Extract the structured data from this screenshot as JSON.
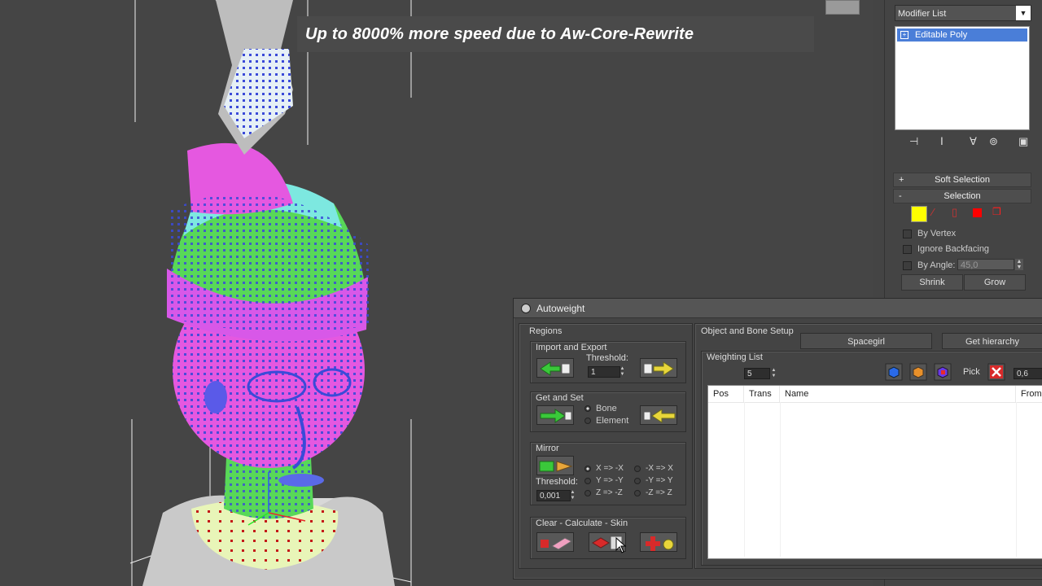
{
  "viewport": {
    "overlay_text": "Up to 8000% more speed due to Aw-Core-Rewrite"
  },
  "command_panel": {
    "modifier_list": "Modifier List",
    "modifier_dropdown_arrow": "▼",
    "stack_items": [
      "Editable Poly"
    ],
    "rollouts": {
      "soft_selection": {
        "sign": "+",
        "label": "Soft Selection"
      },
      "selection": {
        "sign": "-",
        "label": "Selection"
      }
    },
    "checkboxes": {
      "by_vertex": "By Vertex",
      "ignore_backfacing": "Ignore Backfacing",
      "by_angle": "By Angle:"
    },
    "angle_value": "45,0",
    "shrink_label": "Shrink",
    "grow_label": "Grow",
    "colors": {
      "selection_highlight": "#4a7ed8",
      "vertex_icon": "#ffff00",
      "red_icons": "#ff0000"
    }
  },
  "autoweight": {
    "title": "Autoweight",
    "regions": {
      "label": "Regions",
      "import_export": {
        "label": "Import and Export",
        "threshold_label": "Threshold:",
        "threshold_value": "1"
      },
      "get_set": {
        "label": "Get and Set",
        "options": [
          "Bone",
          "Element"
        ],
        "selected": "Bone"
      },
      "mirror": {
        "label": "Mirror",
        "threshold_label": "Threshold:",
        "threshold_value": "0,001",
        "options": [
          "X => -X",
          "-X => X",
          "Y => -Y",
          "-Y => Y",
          "Z => -Z",
          "-Z => Z"
        ],
        "selected": "X => -X"
      },
      "clear_calc": {
        "label": "Clear - Calculate - Skin"
      }
    },
    "object_bone": {
      "label": "Object and Bone Setup",
      "object_button": "Spacegirl",
      "hierarchy_button": "Get hierarchy"
    },
    "weighting_list": {
      "label": "Weighting List",
      "count_value": "5",
      "pick_label": "Pick",
      "value_field": "0,6",
      "columns": [
        "Pos",
        "Trans",
        "Name",
        "From"
      ]
    }
  }
}
